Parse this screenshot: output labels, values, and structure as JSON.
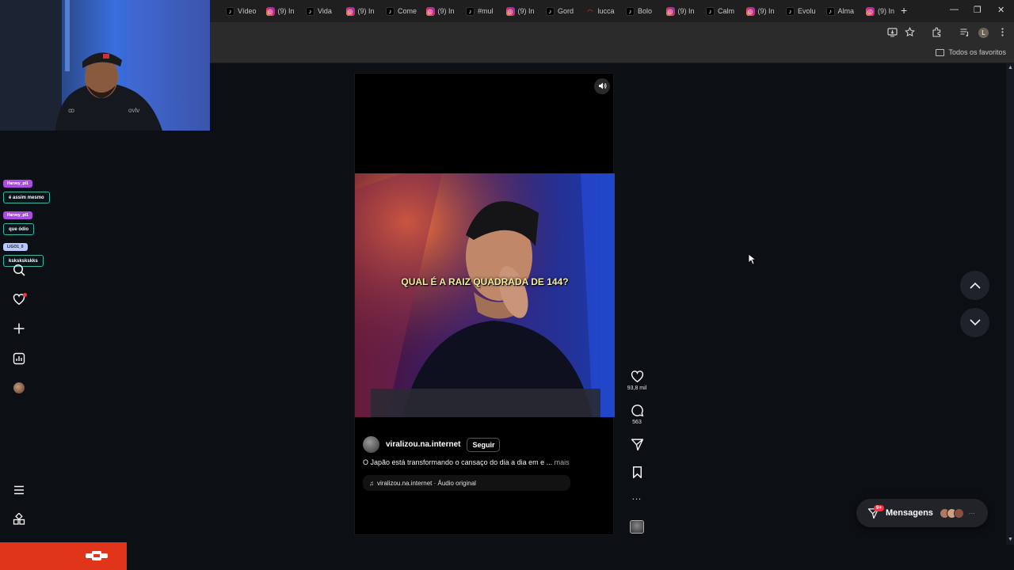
{
  "browser": {
    "tabs": [
      {
        "favicon": "tiktok-icon",
        "title": "Vídeo"
      },
      {
        "favicon": "instagram-icon",
        "title": "(9) In"
      },
      {
        "favicon": "tiktok-icon",
        "title": "Vida"
      },
      {
        "favicon": "instagram-icon",
        "title": "(9) In"
      },
      {
        "favicon": "tiktok-icon",
        "title": "Come"
      },
      {
        "favicon": "instagram-icon",
        "title": "(9) In"
      },
      {
        "favicon": "tiktok-icon",
        "title": "#mul"
      },
      {
        "favicon": "instagram-icon",
        "title": "(9) In"
      },
      {
        "favicon": "tiktok-icon",
        "title": "Gord"
      },
      {
        "favicon": "lucca-icon",
        "title": "lucca"
      },
      {
        "favicon": "tiktok-icon",
        "title": "Bolo"
      },
      {
        "favicon": "instagram-icon",
        "title": "(9) In"
      },
      {
        "favicon": "tiktok-icon",
        "title": "Calm"
      },
      {
        "favicon": "instagram-icon",
        "title": "(9) In"
      },
      {
        "favicon": "tiktok-icon",
        "title": "Evolu"
      },
      {
        "favicon": "tiktok-icon",
        "title": "Alma"
      },
      {
        "favicon": "instagram-icon",
        "title": "(9) In"
      }
    ],
    "new_tab": "+",
    "window_controls": {
      "minimize": "—",
      "restore": "❐",
      "close": "✕"
    },
    "profile_initial": "L",
    "bookmarks_all": "Todos os favoritos"
  },
  "chat": [
    {
      "user": "Harvey_pt1",
      "message": "é assim mesmo"
    },
    {
      "user": "Harvey_pt1",
      "message": "que ódio"
    },
    {
      "user": "LIGO1_0",
      "message": "kskskskskks"
    }
  ],
  "reel": {
    "video_caption": "QUAL É A RAIZ QUADRADA DE 144?",
    "username": "viralizou.na.internet",
    "follow_label": "Seguir",
    "description": "O Japão está transformando o cansaço do dia a dia em e ...",
    "more_label": "mais",
    "audio": "viralizou.na.internet · Áudio original"
  },
  "actions": {
    "likes": "93,8 mil",
    "comments": "563",
    "more": "..."
  },
  "messages": {
    "label": "Mensagens",
    "badge": "9+"
  },
  "colors": {
    "stream_bar": "#e0341b",
    "notification_red": "#ff3040",
    "caption_yellow": "#f6ec9a"
  }
}
